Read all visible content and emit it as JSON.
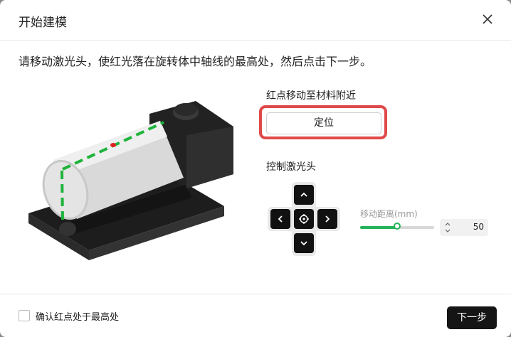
{
  "dialog": {
    "title": "开始建模",
    "close_icon": "close-icon"
  },
  "instruction": "请移动激光头，使红光落在旋转体中轴线的最高处，然后点击下一步。",
  "locate_section": {
    "label": "红点移动至材料附近",
    "button_label": "定位",
    "highlight_color": "#e0494a"
  },
  "laser_control": {
    "label": "控制激光头",
    "buttons": [
      "up-arrow-icon",
      "left-arrow-icon",
      "crosshair-icon",
      "right-arrow-icon",
      "down-arrow-icon"
    ],
    "distance_label": "移动距离(mm)",
    "distance_value": "50",
    "slider_level": 0.5,
    "accent_color": "#23b35a"
  },
  "footer": {
    "confirm_label": "确认红点处于最高处",
    "confirm_checked": false,
    "next_label": "下一步"
  }
}
